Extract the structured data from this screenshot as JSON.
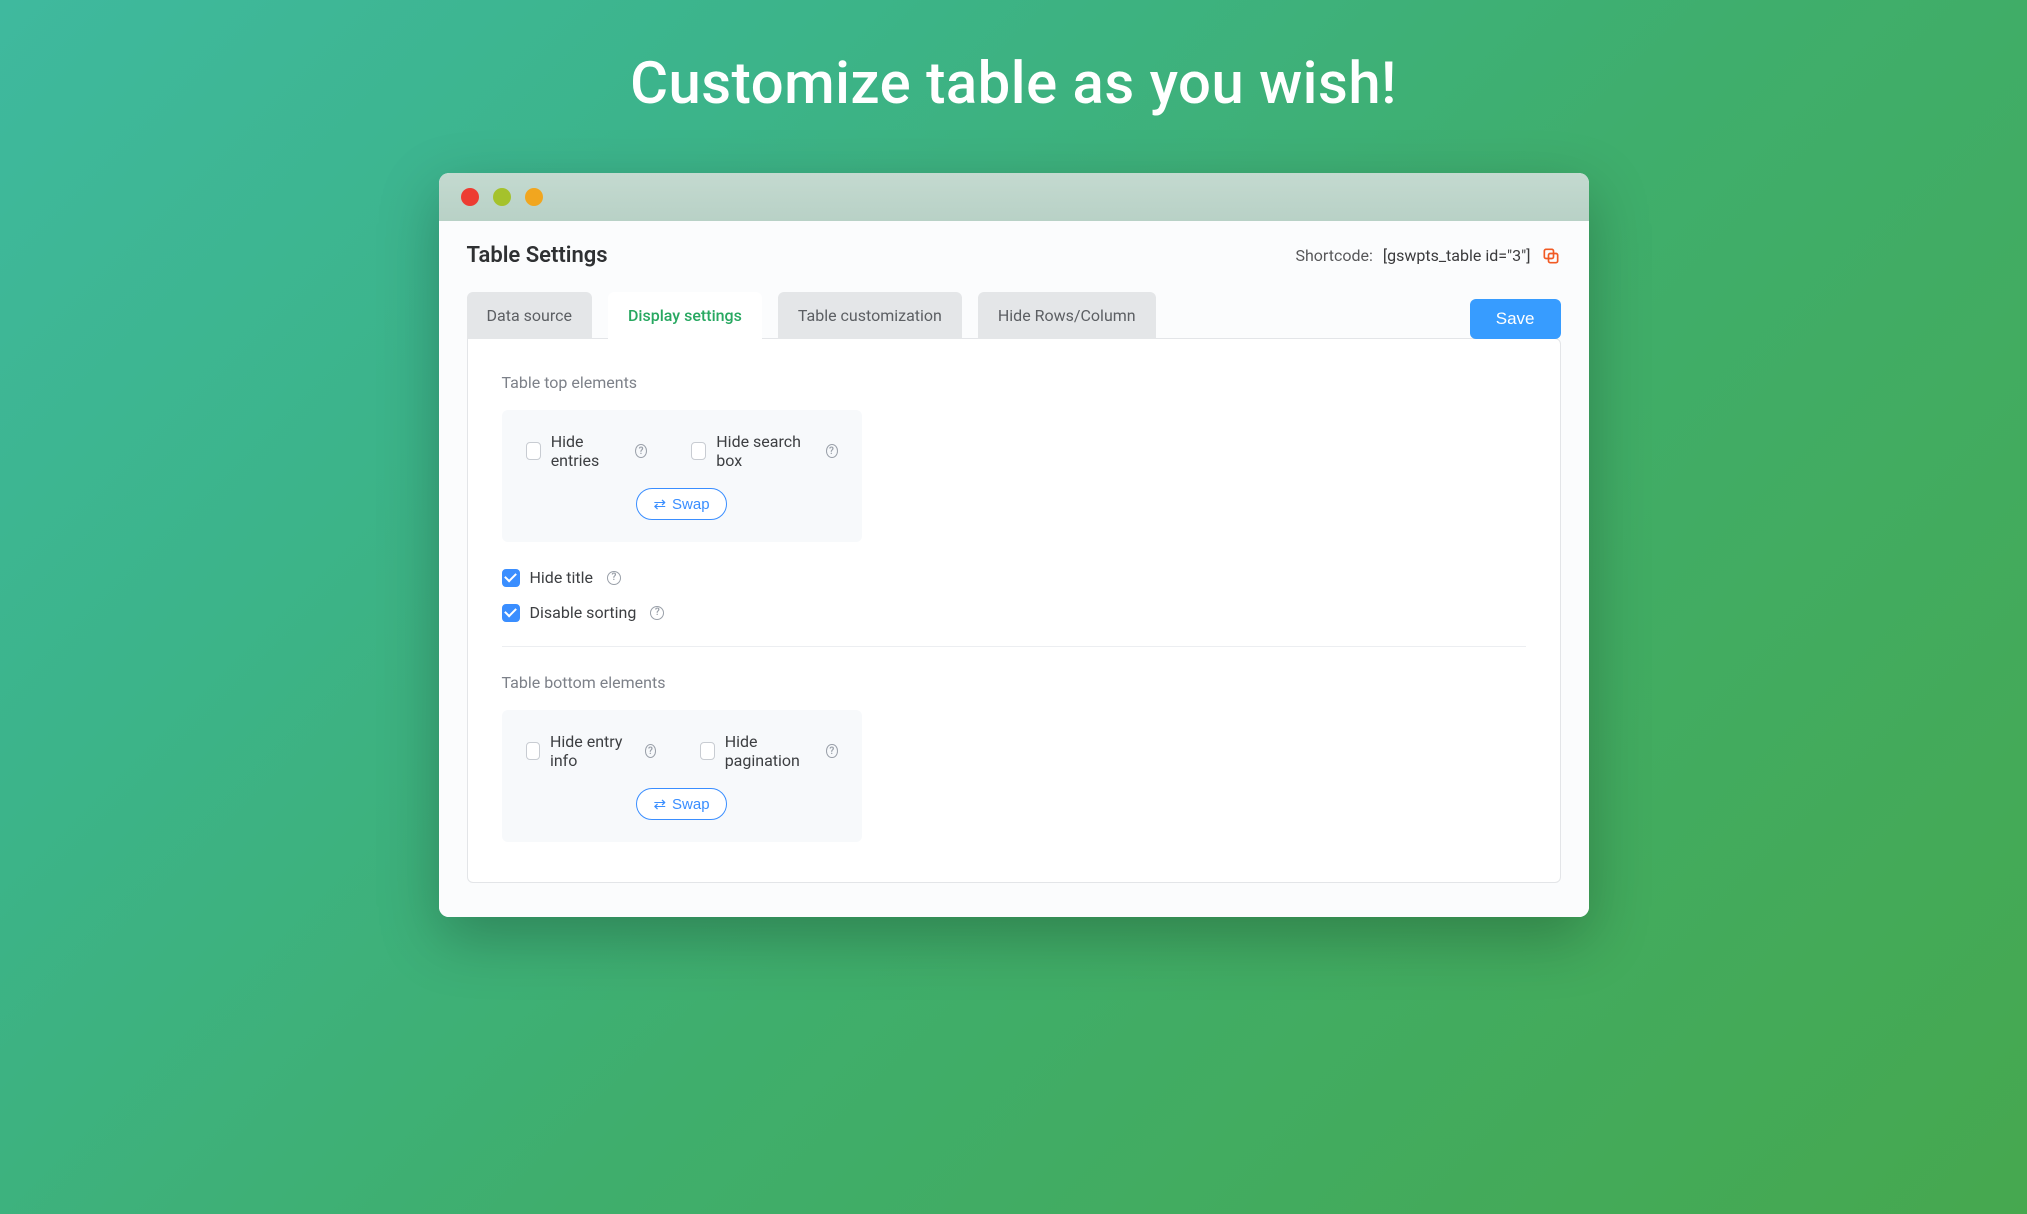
{
  "hero": {
    "title": "Customize table as you wish!"
  },
  "window": {
    "panel_title": "Table Settings",
    "shortcode": {
      "label": "Shortcode:",
      "code": "[gswpts_table id=\"3\"]"
    },
    "tabs": [
      {
        "label": "Data source"
      },
      {
        "label": "Display settings",
        "active": true
      },
      {
        "label": "Table customization"
      },
      {
        "label": "Hide Rows/Column"
      }
    ],
    "save_label": "Save"
  },
  "display_settings": {
    "top_section_title": "Table top elements",
    "top_checks": {
      "hide_entries": {
        "label": "Hide entries",
        "checked": false
      },
      "hide_search_box": {
        "label": "Hide search box",
        "checked": false
      }
    },
    "swap_label": "Swap",
    "standalone": {
      "hide_title": {
        "label": "Hide title",
        "checked": true
      },
      "disable_sorting": {
        "label": "Disable sorting",
        "checked": true
      }
    },
    "bottom_section_title": "Table bottom elements",
    "bottom_checks": {
      "hide_entry_info": {
        "label": "Hide entry info",
        "checked": false
      },
      "hide_pagination": {
        "label": "Hide pagination",
        "checked": false
      }
    }
  },
  "colors": {
    "accent_blue": "#3a8eff",
    "accent_green": "#28a861"
  }
}
